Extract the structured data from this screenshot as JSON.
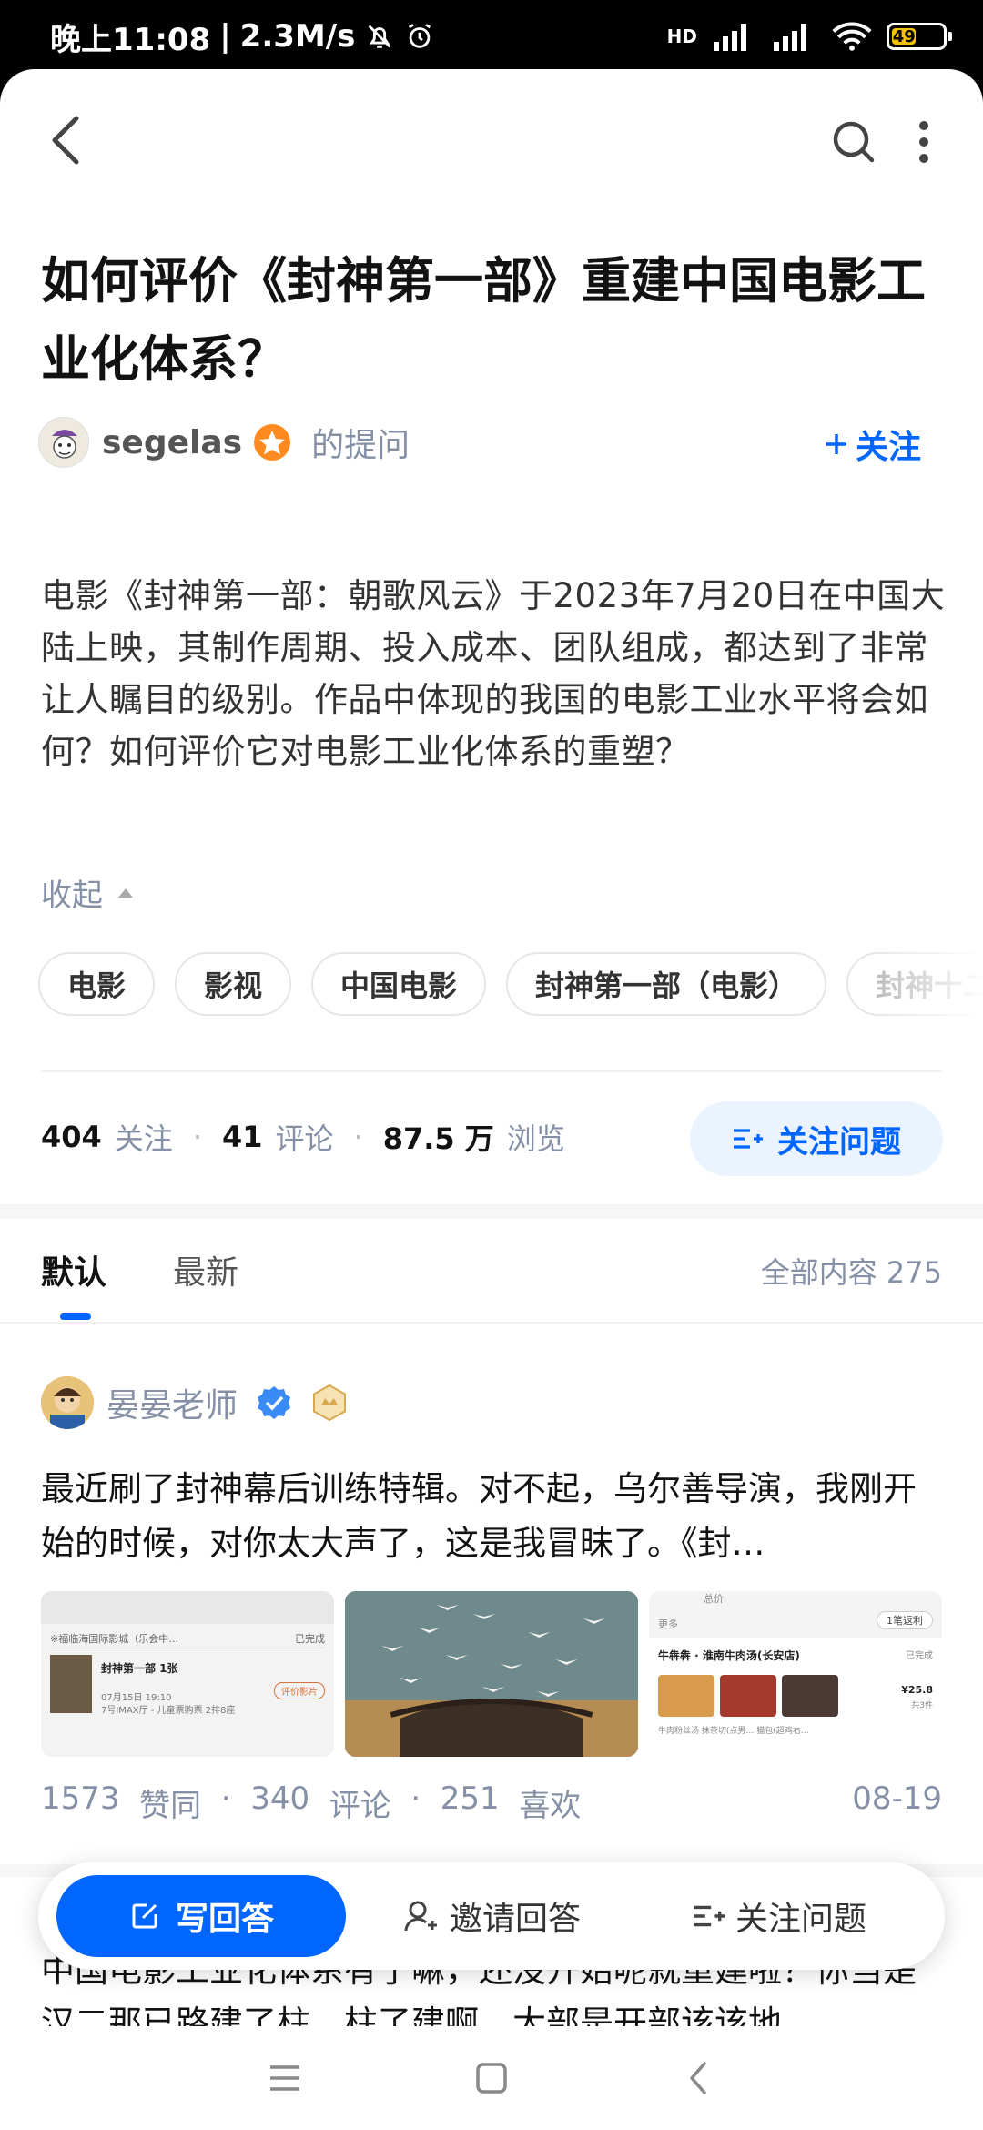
{
  "status_bar": {
    "time": "晚上11:08",
    "speed": "2.3M/s",
    "network": "HD",
    "battery": "49",
    "battery_level": 0.49
  },
  "question": {
    "title": "如何评价《封神第一部》重建中国电影工业化体系？",
    "asker_name": "segelas",
    "asker_suffix": "的提问",
    "follow_user_label": "关注",
    "description": "电影《封神第一部：朝歌风云》于2023年7月20日在中国大陆上映，其制作周期、投入成本、团队组成，都达到了非常让人瞩目的级别。作品中体现的我国的电影工业水平将会如何？如何评价它对电影工业化体系的重塑？",
    "collapse_label": "收起",
    "tags": [
      "电影",
      "影视",
      "中国电影",
      "封神第一部（电影）",
      "封神十二"
    ],
    "stats": {
      "follow_count": "404",
      "follow_label": "关注",
      "comment_count": "41",
      "comment_label": "评论",
      "view_count": "87.5 万",
      "view_label": "浏览"
    },
    "follow_question_label": "关注问题"
  },
  "tabs": {
    "items": [
      "默认",
      "最新"
    ],
    "active": "默认",
    "all_label": "全部内容",
    "all_count": "275"
  },
  "answer": {
    "author": "晏晏老师",
    "excerpt": "最近刷了封神幕后训练特辑。对不起，乌尔善导演，我刚开始的时候，对你太大声了，这是我冒昧了。《封…",
    "thumb1": {
      "header": "※福临海国际影城（乐会中…",
      "status": "已完成",
      "movie": "封神第一部 1张",
      "time": "07月15日 19:10",
      "hall": "7号IMAX厅 - 儿童票购票 2排8座",
      "button": "评价影片"
    },
    "thumb3": {
      "top": "总价",
      "more": "更多",
      "coupon": "1笔返利",
      "shop": "牛犇犇 · 淮南牛肉汤(长安店)",
      "status": "已完成",
      "price": "¥25.8",
      "count": "共3件",
      "items": "牛肉粉丝汤  抹茶切(点男…  猫包(超鸡右…"
    },
    "likes": "1573",
    "likes_label": "赞同",
    "comments": "340",
    "comments_label": "评论",
    "favs": "251",
    "favs_label": "喜欢",
    "date": "08-19"
  },
  "next_answer": {
    "excerpt": "中国电影工业化体系有了嘛，还没开始呢就重建啦？你当是汉二那已路建了柱，柱了建啊。大部是开部该该地"
  },
  "action_bar": {
    "write_label": "写回答",
    "invite_label": "邀请回答",
    "follow_label": "关注问题"
  },
  "colors": {
    "brand_blue": "#0066ff",
    "muted": "#8590a6"
  }
}
